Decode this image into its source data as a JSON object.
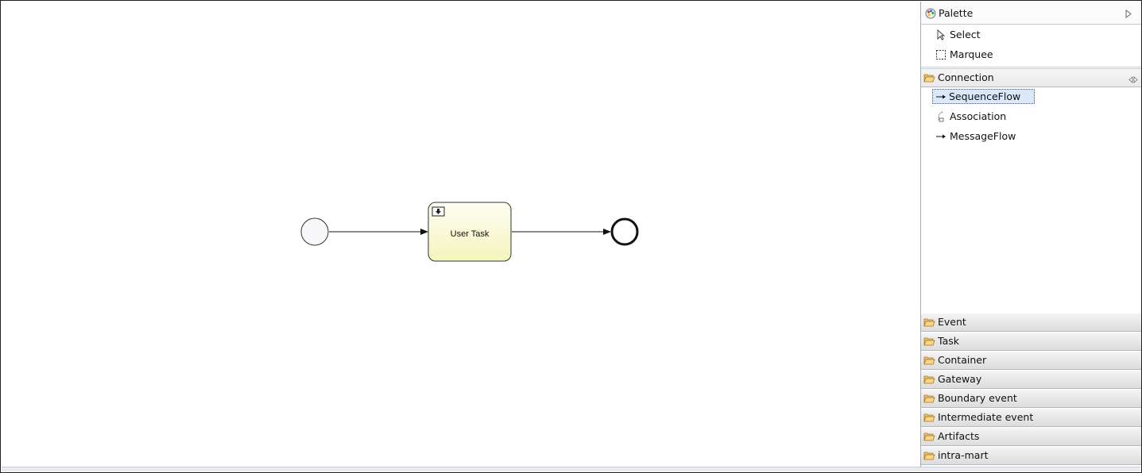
{
  "diagram": {
    "nodes": [
      {
        "kind": "start-event"
      },
      {
        "kind": "user-task",
        "label": "User Task"
      },
      {
        "kind": "end-event"
      }
    ],
    "flows": [
      {
        "from": "start-event",
        "to": "user-task"
      },
      {
        "from": "user-task",
        "to": "end-event"
      }
    ],
    "colors": {
      "task_fill_top": "#fdfdf0",
      "task_fill_bottom": "#f5f5bd",
      "start_fill": "#f7f7fa",
      "stroke": "#111111"
    }
  },
  "palette": {
    "title": "Palette",
    "title_icon": "palette-icon",
    "collapse_icon": "triangle-right-icon",
    "tools": [
      {
        "label": "Select",
        "icon": "arrow-cursor-icon"
      },
      {
        "label": "Marquee",
        "icon": "marquee-icon"
      }
    ],
    "open_drawer": {
      "label": "Connection",
      "icon": "folder-open-icon",
      "pin_icon": "pin-icon",
      "items": [
        {
          "label": "SequenceFlow",
          "icon": "arrow-right-icon",
          "selected": true
        },
        {
          "label": "Association",
          "icon": "association-icon",
          "selected": false
        },
        {
          "label": "MessageFlow",
          "icon": "arrow-right-icon",
          "selected": false
        }
      ]
    },
    "drawers": [
      {
        "label": "Event"
      },
      {
        "label": "Task"
      },
      {
        "label": "Container"
      },
      {
        "label": "Gateway"
      },
      {
        "label": "Boundary event"
      },
      {
        "label": "Intermediate event"
      },
      {
        "label": "Artifacts"
      },
      {
        "label": "intra-mart"
      }
    ],
    "colors": {
      "selected_bg": "#dbe8f9",
      "selected_border": "#2a57a6",
      "folder": "#e8a33c"
    }
  }
}
